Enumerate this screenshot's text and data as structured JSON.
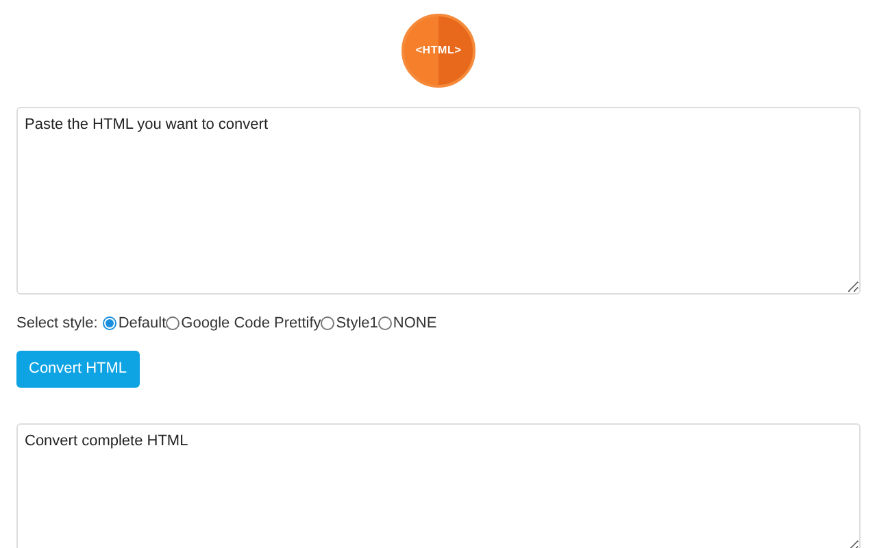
{
  "logo": {
    "text": "<HTML>"
  },
  "input": {
    "placeholder": "Paste the HTML you want to convert"
  },
  "style_label": "Select style:",
  "styles": [
    {
      "label": "Default",
      "selected": true
    },
    {
      "label": "Google Code Prettify",
      "selected": false
    },
    {
      "label": "Style1",
      "selected": false
    },
    {
      "label": "NONE",
      "selected": false
    }
  ],
  "button": "Convert HTML",
  "output": {
    "placeholder": "Convert complete HTML"
  }
}
